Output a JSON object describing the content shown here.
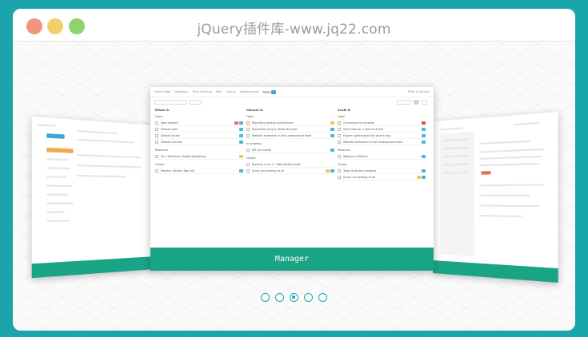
{
  "window": {
    "title": "jQuery插件库-www.jq22.com",
    "controls": [
      "close",
      "minimize",
      "maximize"
    ]
  },
  "slider": {
    "active_index": 2,
    "dots": 5,
    "main_slide": {
      "footer_label": "Manager",
      "nav": {
        "items": [
          "Home Feed",
          "Members",
          "Time Tracking",
          "Wiki",
          "Source",
          "Deployments",
          "Tasks"
        ],
        "active": "Tasks",
        "badge_color": "#3aa7d5",
        "right": "Filter & Actions"
      },
      "columns": [
        {
          "name": "Ethan G.",
          "sections": [
            {
              "title": "Open",
              "tasks": [
                {
                  "name": "Wait Amount",
                  "tags": [
                    "#e8705a",
                    "#46b8d6"
                  ]
                },
                {
                  "name": "Default post",
                  "tags": [
                    "#46b8d6"
                  ]
                },
                {
                  "name": "Default action",
                  "tags": [
                    "#46b8d6"
                  ]
                },
                {
                  "name": "Default process",
                  "tags": [
                    "#46b8d6"
                  ]
                }
              ]
            },
            {
              "title": "Reserved",
              "tasks": [
                {
                  "name": "Fix 3 Members: Digital budgeting",
                  "tags": [
                    "#f2c94c"
                  ]
                }
              ]
            },
            {
              "title": "Closed",
              "tasks": [
                {
                  "name": "Monitor: Version Tag.info",
                  "tags": [
                    "#46b8d6"
                  ]
                }
              ]
            }
          ]
        },
        {
          "name": "Manuel G.",
          "sections": [
            {
              "title": "Open",
              "tasks": [
                {
                  "name": "Reporting backup architecture",
                  "tags": [
                    "#f2c94c"
                  ],
                  "warn": true
                },
                {
                  "name": "Production drop & Model Number",
                  "tags": [
                    "#46b8d6"
                  ]
                },
                {
                  "name": "Website animation in the underground feed",
                  "tags": [
                    "#46b8d6"
                  ]
                }
              ]
            },
            {
              "title": "In progress",
              "tasks": [
                {
                  "name": "API for mobile",
                  "tags": [
                    "#46b8d6"
                  ]
                }
              ]
            },
            {
              "title": "Closed",
              "tasks": [
                {
                  "name": "Booking in on 1.7 Web Models table",
                  "tags": []
                },
                {
                  "name": "Scroll not working at all",
                  "tags": [
                    "#f2c94c",
                    "#46b8d6"
                  ]
                }
              ]
            }
          ]
        },
        {
          "name": "Scott R.",
          "sections": [
            {
              "title": "Open",
              "tasks": [
                {
                  "name": "Conversion to consider",
                  "tags": [
                    "#e84c3d"
                  ],
                  "warn": true
                },
                {
                  "name": "Start data for a data to driver",
                  "tags": [
                    "#46b8d6"
                  ]
                },
                {
                  "name": "Engine optimization for launch app",
                  "tags": [
                    "#46b8d6"
                  ]
                },
                {
                  "name": "Website animation in the underground feed",
                  "tags": [
                    "#46b8d6"
                  ]
                }
              ]
            },
            {
              "title": "Reserved",
              "tasks": [
                {
                  "name": "Weapons Offtrade",
                  "tags": [
                    "#46b8d6"
                  ]
                }
              ]
            },
            {
              "title": "Closed",
              "tasks": [
                {
                  "name": "Total: Business schedule",
                  "tags": [
                    "#46b8d6"
                  ]
                },
                {
                  "name": "Scroll not working at all",
                  "tags": [
                    "#f2c94c",
                    "#46b8d6"
                  ]
                }
              ]
            }
          ]
        }
      ]
    }
  },
  "colors": {
    "backdrop": "#1aa5ad",
    "footer": "#1aa486",
    "close_dot": "#f0967e",
    "min_dot": "#f2cf6d",
    "max_dot": "#8fd26e"
  }
}
